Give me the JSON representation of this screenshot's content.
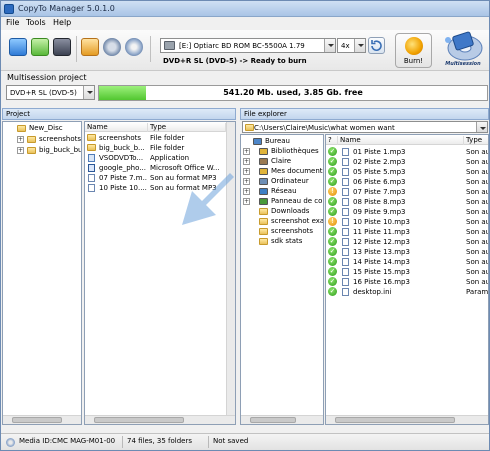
{
  "window": {
    "title": "CopyTo Manager 5.0.1.0"
  },
  "menu": [
    "File",
    "Tools",
    "Help"
  ],
  "toolbar": {
    "drive": "[E:] Optiarc BD ROM BC-5500A 1.79",
    "speed": "4x",
    "media_status": "DVD+R SL (DVD-5) -> Ready to burn",
    "burn_label": "Burn!",
    "logo_text": "Multisession"
  },
  "multisession": {
    "label": "Multisession project",
    "format": "DVD+R SL (DVD-5)",
    "capacity_text": "541.20 Mb. used, 3.85 Gb. free",
    "used_fraction": 0.12
  },
  "project": {
    "title": "Project",
    "tree": [
      {
        "label": "New_Disc",
        "level": 0
      },
      {
        "label": "screenshots",
        "level": 1
      },
      {
        "label": "big_buck_bu",
        "level": 1
      }
    ],
    "columns": [
      "Name",
      "Type"
    ],
    "files": [
      {
        "name": "screenshots",
        "type": "File folder",
        "icon": "folder"
      },
      {
        "name": "big_buck_b...",
        "type": "File folder",
        "icon": "folder"
      },
      {
        "name": "VSODVDTo...",
        "type": "Application",
        "icon": "app"
      },
      {
        "name": "google_pho...",
        "type": "Microsoft Office W...",
        "icon": "doc"
      },
      {
        "name": "07 Piste 7.m...",
        "type": "Son au format MP3",
        "icon": "mp3"
      },
      {
        "name": "10 Piste 10....",
        "type": "Son au format MP3",
        "icon": "mp3"
      }
    ]
  },
  "explorer": {
    "title": "File explorer",
    "path": "C:\\Users\\Claire\\Music\\what women want",
    "tree": [
      {
        "label": "Bureau",
        "level": 0,
        "icon": "desktop"
      },
      {
        "label": "Bibliothèques",
        "level": 1,
        "icon": "library"
      },
      {
        "label": "Claire",
        "level": 1,
        "icon": "user"
      },
      {
        "label": "Mes documents",
        "level": 1,
        "icon": "docs"
      },
      {
        "label": "Ordinateur",
        "level": 1,
        "icon": "computer"
      },
      {
        "label": "Réseau",
        "level": 1,
        "icon": "network"
      },
      {
        "label": "Panneau de confi",
        "level": 1,
        "icon": "control"
      },
      {
        "label": "Downloads",
        "level": 1,
        "icon": "folder"
      },
      {
        "label": "screenshot examp",
        "level": 1,
        "icon": "folder"
      },
      {
        "label": "screenshots",
        "level": 1,
        "icon": "folder"
      },
      {
        "label": "sdk stats",
        "level": 1,
        "icon": "folder"
      }
    ],
    "columns": [
      "?",
      "Name",
      "Type"
    ],
    "files": [
      {
        "name": "01 Piste 1.mp3",
        "type": "Son au",
        "status": "ok"
      },
      {
        "name": "02 Piste 2.mp3",
        "type": "Son au",
        "status": "ok"
      },
      {
        "name": "05 Piste 5.mp3",
        "type": "Son au",
        "status": "ok"
      },
      {
        "name": "06 Piste 6.mp3",
        "type": "Son au",
        "status": "ok"
      },
      {
        "name": "07 Piste 7.mp3",
        "type": "Son au",
        "status": "warn"
      },
      {
        "name": "08 Piste 8.mp3",
        "type": "Son au",
        "status": "ok"
      },
      {
        "name": "09 Piste 9.mp3",
        "type": "Son au",
        "status": "ok"
      },
      {
        "name": "10 Piste 10.mp3",
        "type": "Son au",
        "status": "warn"
      },
      {
        "name": "11 Piste 11.mp3",
        "type": "Son au",
        "status": "ok"
      },
      {
        "name": "12 Piste 12.mp3",
        "type": "Son au",
        "status": "ok"
      },
      {
        "name": "13 Piste 13.mp3",
        "type": "Son au",
        "status": "ok"
      },
      {
        "name": "14 Piste 14.mp3",
        "type": "Son au",
        "status": "ok"
      },
      {
        "name": "15 Piste 15.mp3",
        "type": "Son au",
        "status": "ok"
      },
      {
        "name": "16 Piste 16.mp3",
        "type": "Son au",
        "status": "ok"
      },
      {
        "name": "desktop.ini",
        "type": "Param",
        "status": "ok"
      }
    ]
  },
  "status": {
    "media_id": "Media ID:CMC MAG-M01-00",
    "counts": "74 files, 35 folders",
    "saved": "Not saved"
  },
  "colors": {
    "accent": "#2d6bbf",
    "progress": "#52c630",
    "ok": "#2e9b1b",
    "warn": "#f0a100"
  }
}
